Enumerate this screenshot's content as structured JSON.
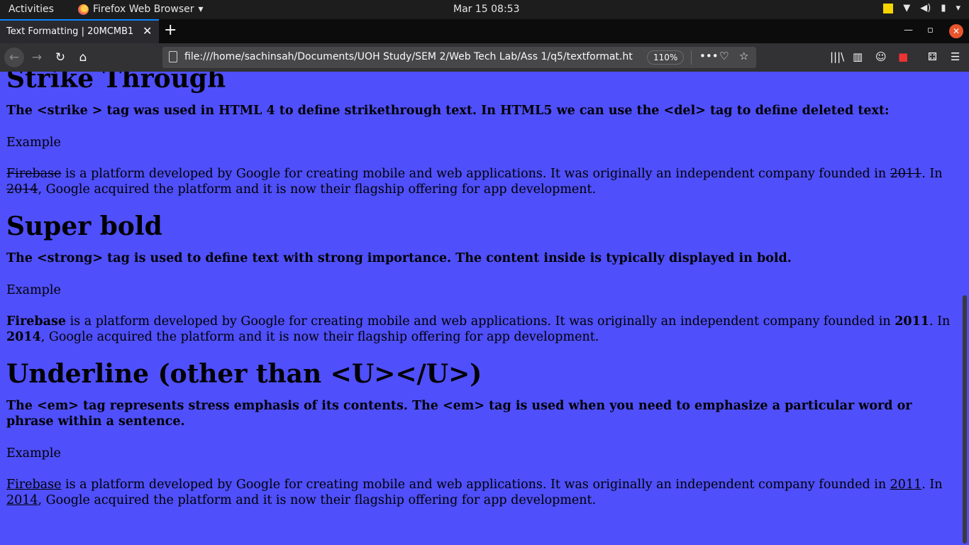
{
  "topbar": {
    "activities": "Activities",
    "app_name": "Firefox Web Browser",
    "clock": "Mar 15  08:53"
  },
  "browser": {
    "tab_title": "Text Formatting | 20MCMB1",
    "url": "file:///home/sachinsah/Documents/UOH Study/SEM 2/Web Tech Lab/Ass 1/q5/textformat.ht",
    "zoom": "110%"
  },
  "page": {
    "strike": {
      "heading": "Strike Through",
      "desc": "The <strike > tag was used in HTML 4 to define strikethrough text. In HTML5 we can use the <del> tag to define deleted text:",
      "example_label": "Example",
      "w_firebase": "Firebase",
      "t1": " is a platform developed by Google for creating mobile and web applications. It was originally an independent company founded in ",
      "w_2011": "2011",
      "t2": ". In ",
      "w_2014": "2014",
      "t3": ", Google acquired the platform and it is now their flagship offering for app development."
    },
    "bold": {
      "heading": "Super bold",
      "desc": "The <strong> tag is used to define text with strong importance. The content inside is typically displayed in bold.",
      "example_label": "Example",
      "w_firebase": "Firebase",
      "t1": " is a platform developed by Google for creating mobile and web applications. It was originally an independent company founded in ",
      "w_2011": "2011",
      "t2": ". In ",
      "w_2014": "2014",
      "t3": ", Google acquired the platform and it is now their flagship offering for app development."
    },
    "underline": {
      "heading": "Underline (other than <U></U>)",
      "desc": "The <em> tag represents stress emphasis of its contents. The <em> tag is used when you need to emphasize a particular word or phrase within a sentence.",
      "example_label": "Example",
      "w_firebase": "Firebase",
      "t1": " is a platform developed by Google for creating mobile and web applications. It was originally an independent company founded in ",
      "w_2011": "2011",
      "t2": ". In ",
      "w_2014": "2014",
      "t3": ", Google acquired the platform and it is now their flagship offering for app development."
    }
  }
}
